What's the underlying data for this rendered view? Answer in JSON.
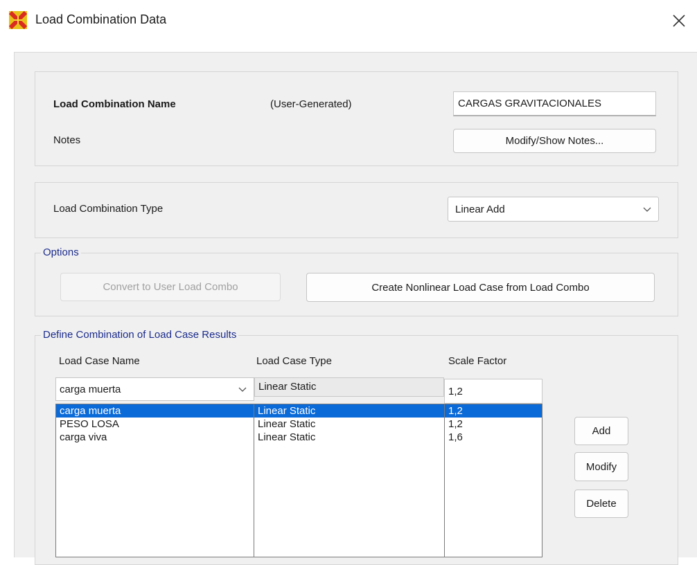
{
  "window": {
    "title": "Load Combination Data"
  },
  "name_section": {
    "name_label": "Load Combination Name",
    "generated_label": "(User-Generated)",
    "name_value": "CARGAS GRAVITACIONALES",
    "notes_label": "Notes",
    "notes_button": "Modify/Show Notes..."
  },
  "type_section": {
    "type_label": "Load Combination Type",
    "type_value": "Linear Add"
  },
  "options": {
    "title": "Options",
    "convert_button": "Convert to User Load Combo",
    "create_button": "Create Nonlinear Load Case from Load Combo"
  },
  "define": {
    "title": "Define Combination of Load Case Results",
    "headers": {
      "name": "Load Case Name",
      "type": "Load Case Type",
      "scale": "Scale Factor"
    },
    "current": {
      "name": "carga muerta",
      "type": "Linear Static",
      "scale": "1,2"
    },
    "rows": [
      {
        "name": "carga muerta",
        "type": "Linear Static",
        "scale": "1,2"
      },
      {
        "name": "PESO LOSA",
        "type": "Linear Static",
        "scale": "1,2"
      },
      {
        "name": "carga viva",
        "type": "Linear Static",
        "scale": "1,6"
      }
    ],
    "selected_row": 0,
    "add_button": "Add",
    "modify_button": "Modify",
    "delete_button": "Delete"
  },
  "colors": {
    "group_title": "#1c2c8c",
    "selection": "#0a6ad8"
  }
}
